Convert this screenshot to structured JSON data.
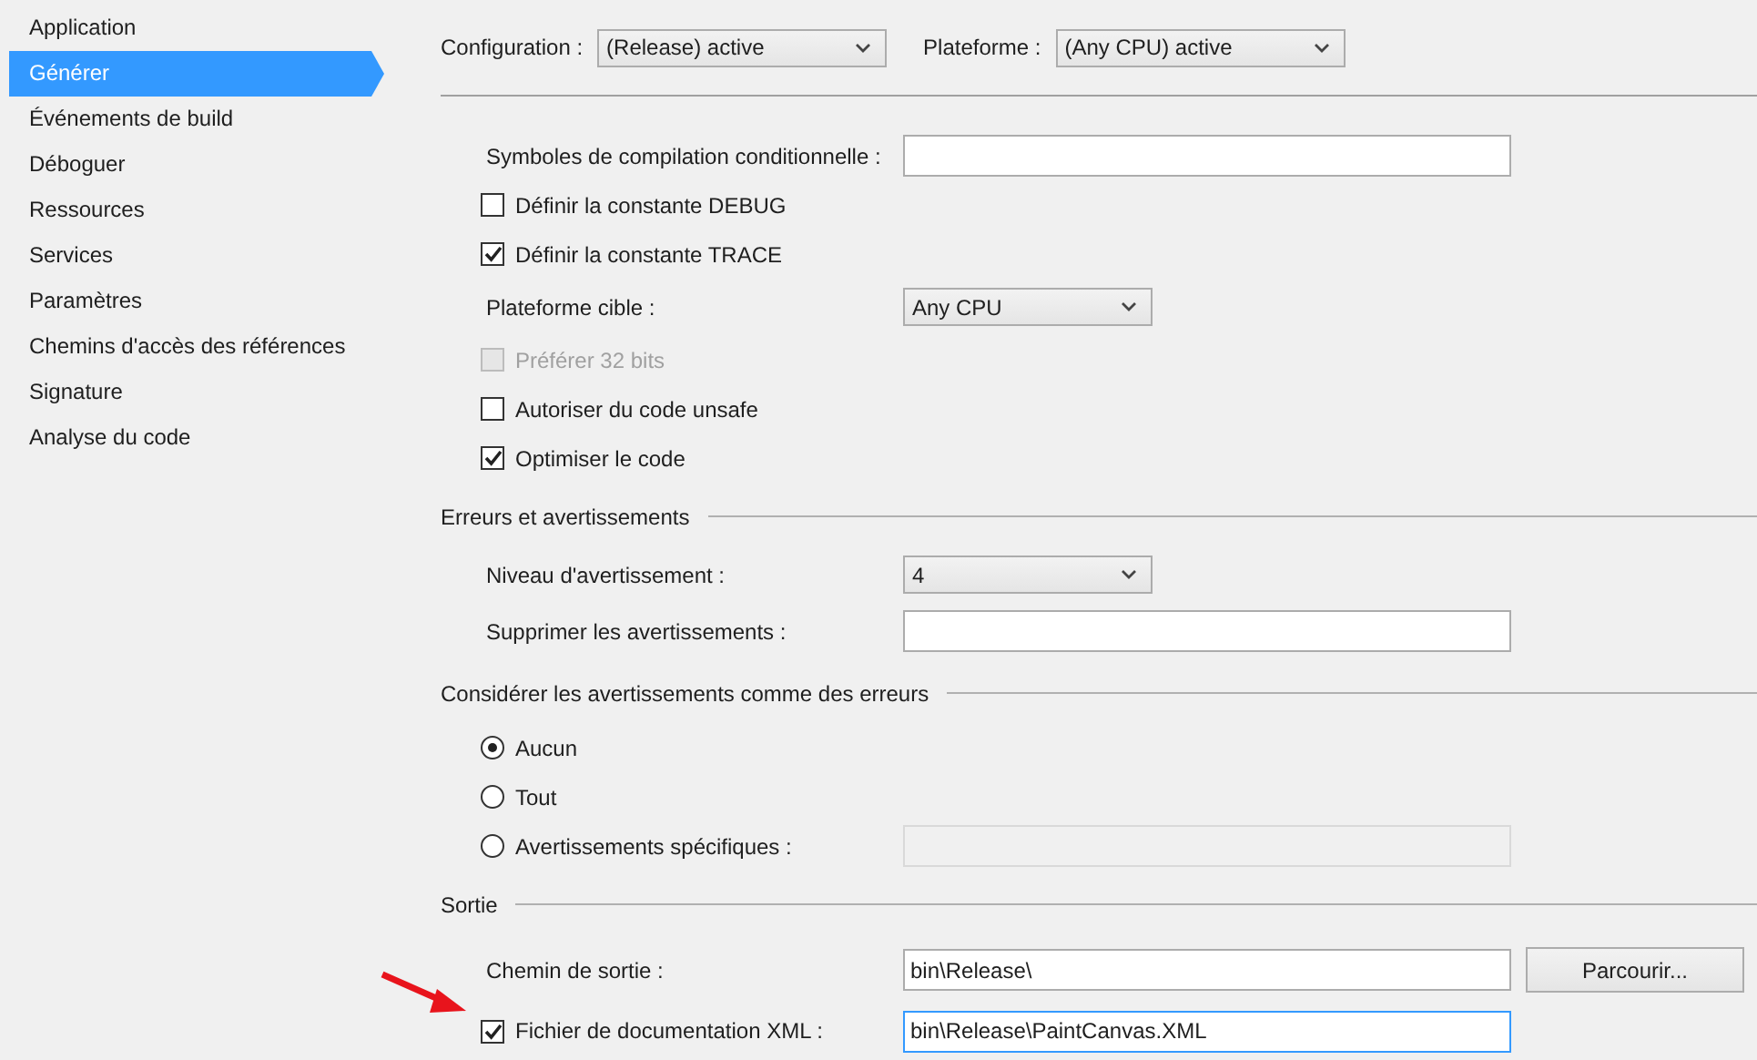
{
  "sidebar": {
    "items": [
      {
        "label": "Application",
        "selected": false
      },
      {
        "label": "Générer",
        "selected": true
      },
      {
        "label": "Événements de build",
        "selected": false
      },
      {
        "label": "Déboguer",
        "selected": false
      },
      {
        "label": "Ressources",
        "selected": false
      },
      {
        "label": "Services",
        "selected": false
      },
      {
        "label": "Paramètres",
        "selected": false
      },
      {
        "label": "Chemins d'accès des références",
        "selected": false
      },
      {
        "label": "Signature",
        "selected": false
      },
      {
        "label": "Analyse du code",
        "selected": false
      }
    ]
  },
  "toolbar": [
    {
      "label": "Configuration :",
      "value": "(Release) active"
    },
    {
      "label": "Plateforme :",
      "value": "(Any CPU) active"
    }
  ],
  "rows": [
    {
      "kind": "field",
      "label": "Symboles de compilation conditionnelle :",
      "value": "",
      "disabled": false
    },
    {
      "kind": "check",
      "label": "Définir la constante DEBUG",
      "checked": false,
      "disabled": false
    },
    {
      "kind": "check",
      "label": "Définir la constante TRACE",
      "checked": true,
      "disabled": false
    },
    {
      "kind": "select",
      "label": "Plateforme cible :",
      "value": "Any CPU"
    },
    {
      "kind": "check",
      "label": "Préférer 32 bits",
      "checked": false,
      "disabled": true
    },
    {
      "kind": "check",
      "label": "Autoriser du code unsafe",
      "checked": false,
      "disabled": false
    },
    {
      "kind": "check",
      "label": "Optimiser le code",
      "checked": true,
      "disabled": false
    },
    {
      "kind": "section",
      "label": "Erreurs et avertissements"
    },
    {
      "kind": "select",
      "label": "Niveau d'avertissement :",
      "value": "4"
    },
    {
      "kind": "field",
      "label": "Supprimer les avertissements :",
      "value": "",
      "disabled": false
    },
    {
      "kind": "section",
      "label": "Considérer les avertissements comme des erreurs"
    },
    {
      "kind": "radio",
      "label": "Aucun",
      "selected": true
    },
    {
      "kind": "radio",
      "label": "Tout",
      "selected": false
    },
    {
      "kind": "radiofield",
      "label": "Avertissements spécifiques :",
      "selected": false,
      "value": "",
      "disabled": true
    },
    {
      "kind": "section",
      "label": "Sortie"
    },
    {
      "kind": "fieldbutton",
      "label": "Chemin de sortie :",
      "value": "bin\\Release\\",
      "button": "Parcourir..."
    },
    {
      "kind": "checkfield",
      "label": "Fichier de documentation XML :",
      "checked": true,
      "value": "bin\\Release\\PaintCanvas.XML",
      "focused": true
    }
  ]
}
